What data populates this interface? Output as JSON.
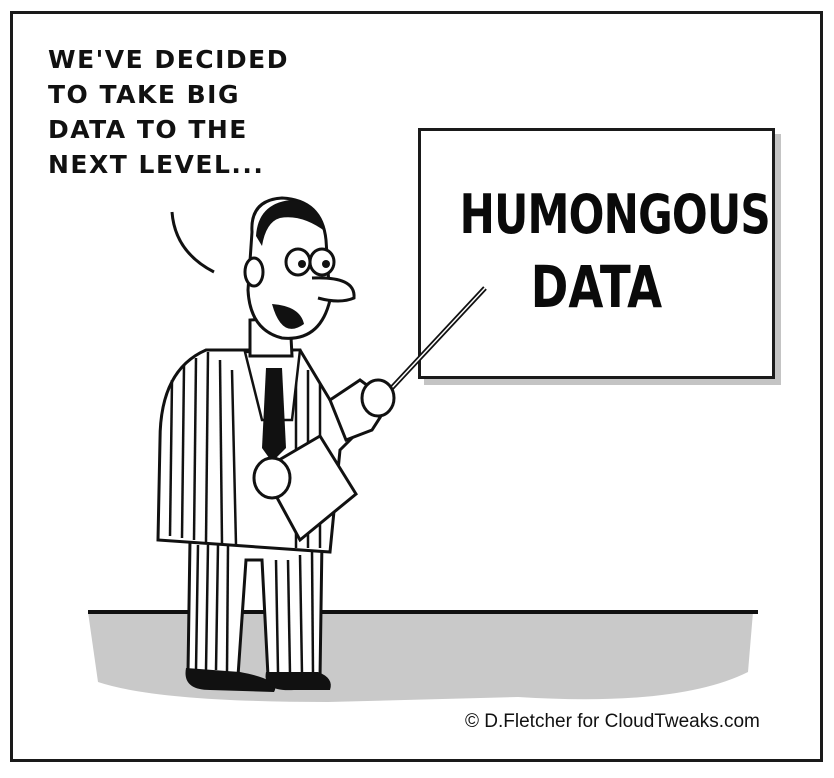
{
  "speech": {
    "lines": [
      "WE'VE DECIDED",
      "TO TAKE BIG",
      "DATA TO THE",
      "NEXT LEVEL..."
    ]
  },
  "board": {
    "line1": "HUMONGOUS",
    "line2": "DATA"
  },
  "credit": "© D.Fletcher for CloudTweaks.com",
  "colors": {
    "ink": "#111111",
    "floor": "#c9c9c9",
    "board_shadow": "#c4c4c4"
  }
}
